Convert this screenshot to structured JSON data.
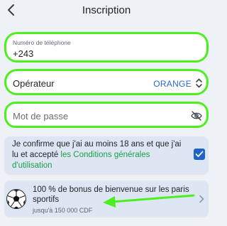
{
  "header": {
    "title": "Inscription",
    "back_icon": "chevron-left-icon"
  },
  "phone": {
    "label": "Numéro de téléphone",
    "value": "+243"
  },
  "operator": {
    "label": "Opérateur",
    "value": "ORANGE"
  },
  "password": {
    "placeholder": "Mot de passe",
    "icon": "eye-off-icon"
  },
  "terms": {
    "text": "Je confirme que j'ai au moins 18 ans et que j'ai lu et accepté ",
    "link": "les Conditions générales d'utilisation",
    "checked": true
  },
  "bonus": {
    "title": "100 % de bonus de bienvenue sur les paris sportifs",
    "subtitle": "jusqu'à 150 000 CDF",
    "icon": "soccer-ball-icon"
  },
  "colors": {
    "highlight": "#4cf01f",
    "accent_blue": "#1e63c6",
    "link_green": "#1aa04a",
    "background": "#eef1f6",
    "card": "#dde6f2"
  }
}
